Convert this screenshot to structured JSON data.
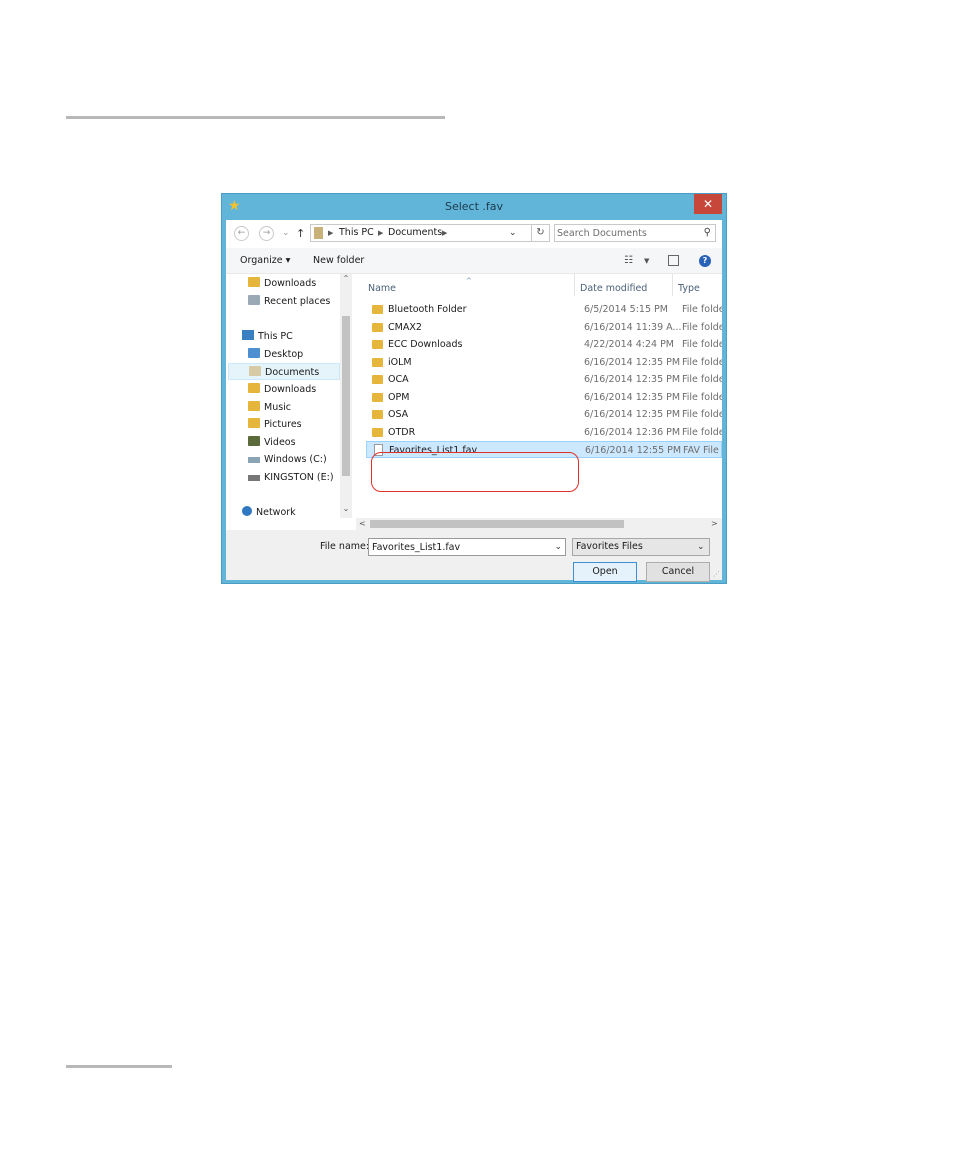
{
  "dialog": {
    "title": "Select .fav",
    "close_glyph": "✕"
  },
  "address": {
    "back_glyph": "←",
    "forward_glyph": "→",
    "recent_glyph": "⌄",
    "up_glyph": "↑",
    "crumbs": [
      "This PC",
      "Documents"
    ],
    "refresh_glyph": "↻",
    "search_placeholder": "Search Documents",
    "search_glyph": "⚲"
  },
  "toolbar": {
    "organize_label": "Organize ▾",
    "new_folder_label": "New folder",
    "help_glyph": "?"
  },
  "nav": {
    "items": [
      {
        "label": "Downloads"
      },
      {
        "label": "Recent places"
      },
      {
        "label": "This PC"
      },
      {
        "label": "Desktop"
      },
      {
        "label": "Documents"
      },
      {
        "label": "Downloads"
      },
      {
        "label": "Music"
      },
      {
        "label": "Pictures"
      },
      {
        "label": "Videos"
      },
      {
        "label": "Windows (C:)"
      },
      {
        "label": "KINGSTON (E:)"
      },
      {
        "label": "Network"
      }
    ]
  },
  "columns": {
    "name": "Name",
    "date": "Date modified",
    "type": "Type"
  },
  "files": [
    {
      "name": "Bluetooth Folder",
      "date": "6/5/2014 5:15 PM",
      "type": "File folder"
    },
    {
      "name": "CMAX2",
      "date": "6/16/2014 11:39 A...",
      "type": "File folder"
    },
    {
      "name": "ECC Downloads",
      "date": "4/22/2014 4:24 PM",
      "type": "File folder"
    },
    {
      "name": "iOLM",
      "date": "6/16/2014 12:35 PM",
      "type": "File folder"
    },
    {
      "name": "OCA",
      "date": "6/16/2014 12:35 PM",
      "type": "File folder"
    },
    {
      "name": "OPM",
      "date": "6/16/2014 12:35 PM",
      "type": "File folder"
    },
    {
      "name": "OSA",
      "date": "6/16/2014 12:35 PM",
      "type": "File folder"
    },
    {
      "name": "OTDR",
      "date": "6/16/2014 12:36 PM",
      "type": "File folder"
    },
    {
      "name": "Favorites_List1.fav",
      "date": "6/16/2014 12:55 PM",
      "type": "FAV File"
    }
  ],
  "bottom": {
    "file_name_label": "File name:",
    "file_name_value": "Favorites_List1.fav",
    "file_type": "Favorites Files",
    "open_label": "Open",
    "cancel_label": "Cancel"
  },
  "colors": {
    "title_bar": "#60b5d8",
    "close_button": "#c7483a",
    "highlight_ring": "#e0302a",
    "selection": "#cce8ff"
  }
}
